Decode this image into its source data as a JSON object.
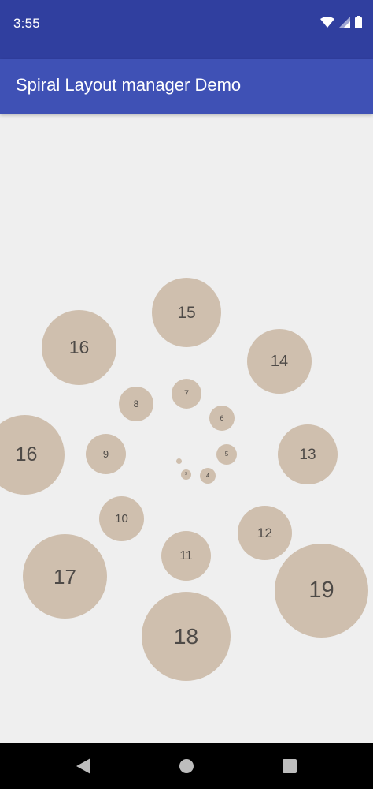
{
  "status_bar": {
    "time": "3:55",
    "icons": [
      "wifi-icon",
      "cell-signal-icon",
      "battery-icon"
    ]
  },
  "app_bar": {
    "title": "Spiral Layout manager Demo",
    "color": "#3f51b5",
    "status_color": "#303f9f"
  },
  "spiral": {
    "bubble_color": "#cfbfae",
    "text_color": "#4e4a47",
    "items": [
      {
        "label": ""
      },
      {
        "label": "3"
      },
      {
        "label": "4"
      },
      {
        "label": "5"
      },
      {
        "label": "6"
      },
      {
        "label": "7"
      },
      {
        "label": "8"
      },
      {
        "label": "9"
      },
      {
        "label": "10"
      },
      {
        "label": "11"
      },
      {
        "label": "12"
      },
      {
        "label": "13"
      },
      {
        "label": "14"
      },
      {
        "label": "15"
      },
      {
        "label": "16"
      },
      {
        "label": "16"
      },
      {
        "label": "17"
      },
      {
        "label": "18"
      },
      {
        "label": "19"
      }
    ]
  },
  "nav_bar": {
    "buttons": [
      "back-icon",
      "home-icon",
      "recents-icon"
    ]
  }
}
